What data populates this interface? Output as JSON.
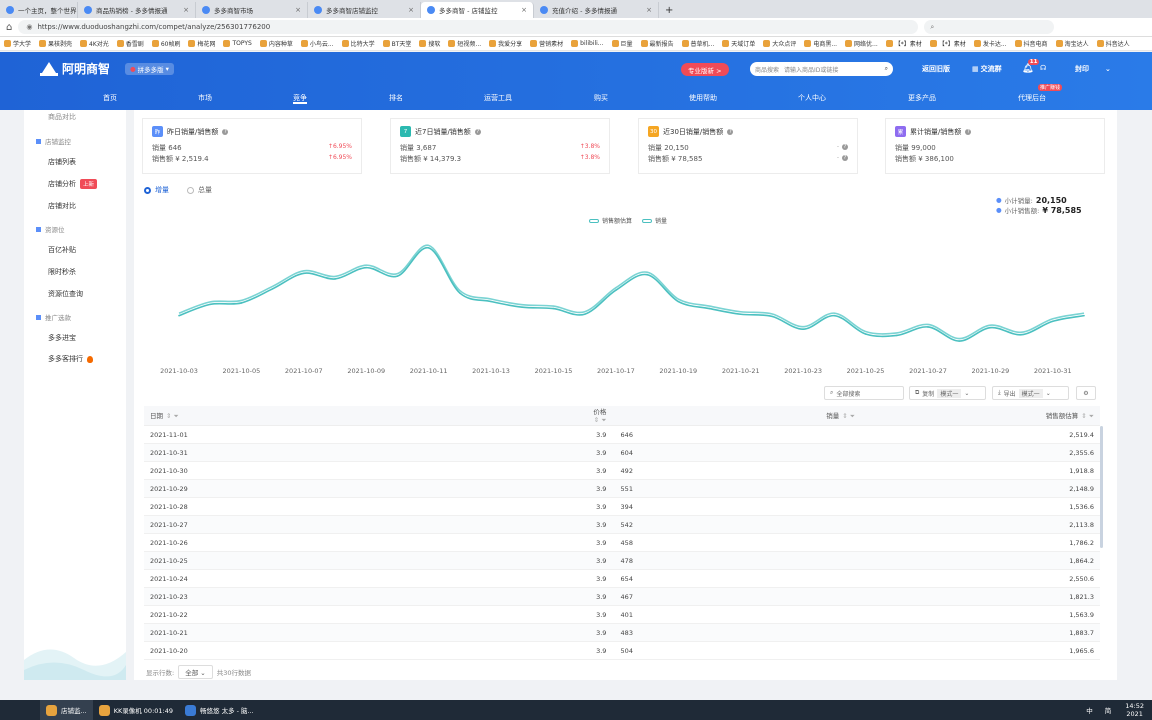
{
  "browser": {
    "tabs": [
      {
        "label": "一个主页，整个世界",
        "active": false
      },
      {
        "label": "商品热销榜 - 多多情报通",
        "active": false
      },
      {
        "label": "多多商智市场",
        "active": false
      },
      {
        "label": "多多商智店铺监控",
        "active": false
      },
      {
        "label": "多多商智 - 店铺监控",
        "active": true
      },
      {
        "label": "充值介绍 - 多多情报通",
        "active": false
      }
    ],
    "new_tab": "+",
    "url": "https://www.duoduoshangzhi.com/compet/analyze/256301776200",
    "bookmarks": [
      "学大学",
      "果核剥壳",
      "4K对光",
      "香雪剧",
      "60帧刷",
      "梅花网",
      "TOPYS",
      "内容种草",
      "小鸟云...",
      "比特大学",
      "BT天堂",
      "搜软",
      "短视频...",
      "我爱分享",
      "营销素材",
      "bilibili...",
      "巨量",
      "最新报告",
      "普草机...",
      "天域订单",
      "大众点评",
      "电商黑...",
      "网络优...",
      "【*】素材",
      "【*】素材",
      "发卡达...",
      "抖音电商",
      "淘宝达人",
      "抖音达人"
    ]
  },
  "header": {
    "brand": "阿明商智",
    "platform": "拼多多版",
    "promo": "专业版新 >",
    "search_scope": "商品搜索",
    "search_placeholder": "请输入商品ID或链接",
    "links": [
      "返回旧版",
      "交流群",
      "封印"
    ],
    "notif_count": "11",
    "nav": [
      "首页",
      "市场",
      "竞争",
      "排名",
      "运营工具",
      "购买",
      "使用帮助",
      "个人中心",
      "更多产品",
      "代理后台"
    ],
    "active_nav": "竞争",
    "nav_badge": "推广赚钱"
  },
  "sidebar": {
    "partial_top": "商品对比",
    "groups": [
      {
        "label": "店铺监控",
        "items": [
          "店铺列表",
          "店铺分析",
          "店铺对比"
        ]
      },
      {
        "label": "资源位",
        "items": [
          "百亿补贴",
          "限时秒杀",
          "资源位查询"
        ]
      },
      {
        "label": "推广选款",
        "items": [
          "多多进宝",
          "多多客排行"
        ]
      }
    ],
    "new_tag": "上新"
  },
  "cards": [
    {
      "icon": "昨",
      "color": "#5b8ff9",
      "title": "昨日销量/销售额",
      "qty_label": "销量",
      "qty": "646",
      "amt_label": "销售额",
      "amt": "¥ 2,519.4",
      "qty_change": "6.95%",
      "amt_change": "6.95%"
    },
    {
      "icon": "7",
      "color": "#2bb9b0",
      "title": "近7日销量/销售额",
      "qty_label": "销量",
      "qty": "3,687",
      "amt_label": "销售额",
      "amt": "¥ 14,379.3",
      "qty_change": "3.8%",
      "amt_change": "3.8%"
    },
    {
      "icon": "30",
      "color": "#f5a623",
      "title": "近30日销量/销售额",
      "qty_label": "销量",
      "qty": "20,150",
      "amt_label": "销售额",
      "amt": "¥ 78,585",
      "qty_change": "-",
      "amt_change": "-"
    },
    {
      "icon": "累",
      "color": "#8e6cf0",
      "title": "累计销量/销售额",
      "qty_label": "销量",
      "qty": "99,000",
      "amt_label": "销售额",
      "amt": "¥ 386,100",
      "qty_change": "",
      "amt_change": ""
    }
  ],
  "mode": {
    "increment": "增量",
    "total": "总量"
  },
  "summary": {
    "qty_label": "小计销量:",
    "qty": "20,150",
    "amt_label": "小计销售额:",
    "amt": "¥ 78,585"
  },
  "chart_data": {
    "type": "line",
    "series": [
      {
        "name": "销售额估算",
        "color": "#7ad3d3"
      },
      {
        "name": "销量",
        "color": "#4bc0c0"
      }
    ],
    "x": [
      "2021-10-03",
      "2021-10-04",
      "2021-10-05",
      "2021-10-06",
      "2021-10-07",
      "2021-10-08",
      "2021-10-09",
      "2021-10-10",
      "2021-10-11",
      "2021-10-12",
      "2021-10-13",
      "2021-10-14",
      "2021-10-15",
      "2021-10-16",
      "2021-10-17",
      "2021-10-18",
      "2021-10-19",
      "2021-10-20",
      "2021-10-21",
      "2021-10-22",
      "2021-10-23",
      "2021-10-24",
      "2021-10-25",
      "2021-10-26",
      "2021-10-27",
      "2021-10-28",
      "2021-10-29",
      "2021-10-30",
      "2021-10-31",
      "2021-11-01"
    ],
    "values": [
      600,
      680,
      690,
      790,
      900,
      860,
      940,
      880,
      1080,
      760,
      700,
      660,
      650,
      610,
      780,
      890,
      700,
      650,
      610,
      595,
      504,
      600,
      470,
      460,
      520,
      420,
      515,
      465,
      560,
      600
    ],
    "tick_labels": [
      "2021-10-03",
      "2021-10-05",
      "2021-10-07",
      "2021-10-09",
      "2021-10-11",
      "2021-10-13",
      "2021-10-15",
      "2021-10-17",
      "2021-10-19",
      "2021-10-21",
      "2021-10-23",
      "2021-10-25",
      "2021-10-27",
      "2021-10-29",
      "2021-10-31"
    ],
    "legend": "top-center"
  },
  "toolbar": {
    "search_placeholder": "全部搜索",
    "copy": "复制",
    "copy_mode": "模式一",
    "export": "导出",
    "export_mode": "模式一"
  },
  "table": {
    "headers": [
      "日期",
      "价格",
      "销量",
      "销售额估算"
    ],
    "rows": [
      [
        "2021-11-01",
        "3.9",
        "646",
        "2,519.4"
      ],
      [
        "2021-10-31",
        "3.9",
        "604",
        "2,355.6"
      ],
      [
        "2021-10-30",
        "3.9",
        "492",
        "1,918.8"
      ],
      [
        "2021-10-29",
        "3.9",
        "551",
        "2,148.9"
      ],
      [
        "2021-10-28",
        "3.9",
        "394",
        "1,536.6"
      ],
      [
        "2021-10-27",
        "3.9",
        "542",
        "2,113.8"
      ],
      [
        "2021-10-26",
        "3.9",
        "458",
        "1,786.2"
      ],
      [
        "2021-10-25",
        "3.9",
        "478",
        "1,864.2"
      ],
      [
        "2021-10-24",
        "3.9",
        "654",
        "2,550.6"
      ],
      [
        "2021-10-23",
        "3.9",
        "467",
        "1,821.3"
      ],
      [
        "2021-10-22",
        "3.9",
        "401",
        "1,563.9"
      ],
      [
        "2021-10-21",
        "3.9",
        "483",
        "1,883.7"
      ],
      [
        "2021-10-20",
        "3.9",
        "504",
        "1,965.6"
      ]
    ],
    "footer_label": "显示行数:",
    "footer_select": "全部",
    "footer_total": "共30行数据"
  },
  "taskbar": {
    "items": [
      "店铺监...",
      "KK录像机 00:01:49",
      "畅悠悠 太多 - 脑..."
    ],
    "tray": [
      "中",
      "简"
    ],
    "clock": "14:52",
    "date": "2021"
  }
}
